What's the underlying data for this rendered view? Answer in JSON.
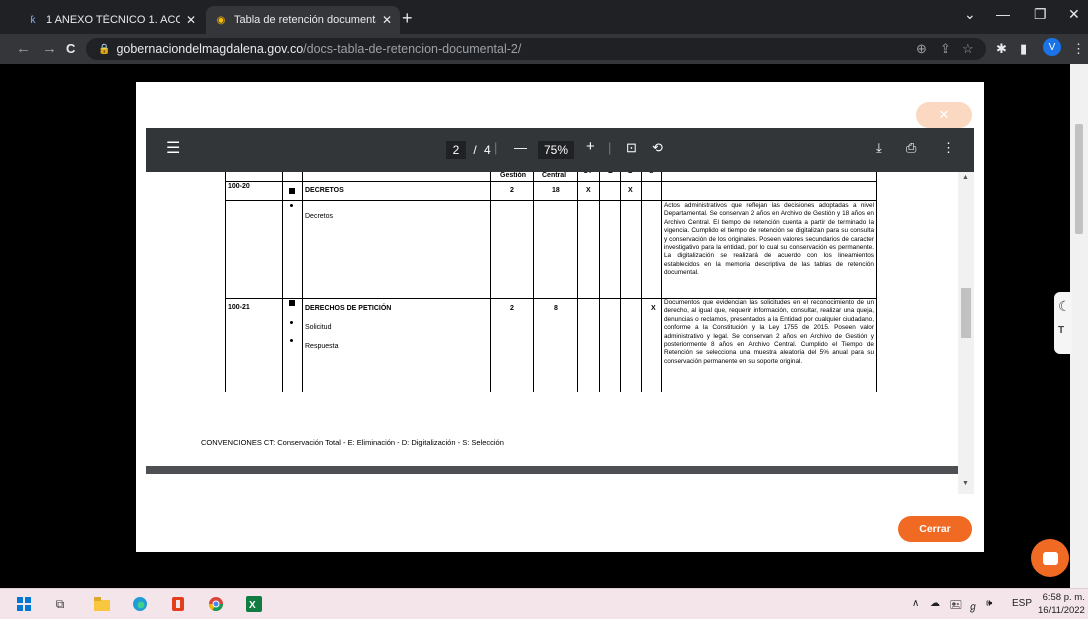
{
  "browser": {
    "tabs": [
      {
        "title": "1 ANEXO TÉCNICO 1. ACCESIBILI",
        "close": "✕"
      },
      {
        "title": "Tabla de retención documental 2",
        "close": "✕"
      }
    ],
    "new_tab": "+",
    "window_controls": [
      "⌄",
      "—",
      "❐",
      "✕"
    ],
    "nav": [
      "←",
      "→",
      "C"
    ],
    "url_host": "gobernaciondelmagdalena.gov.co",
    "url_path": "/docs-tabla-de-retencion-documental-2/",
    "right_icons": [
      "⊕",
      "⇪",
      "☆",
      "✱",
      "▮"
    ],
    "avatar": "V"
  },
  "modal": {
    "close_label": "✕",
    "cerrar_label": "Cerrar"
  },
  "pdf_toolbar": {
    "page_current": "2",
    "page_sep": "/",
    "page_total": "4",
    "zoom_out": "—",
    "zoom": "75%",
    "zoom_in": "+"
  },
  "doc": {
    "header_cols": [
      "Gestión",
      "Central",
      "CT",
      "E",
      "D",
      "S"
    ],
    "rows": [
      {
        "code": "100-20",
        "series": "DECRETOS",
        "gestion": "2",
        "central": "18",
        "marks": {
          "ct": "X",
          "e": "",
          "d": "X",
          "s": ""
        },
        "subseries": [
          "Decretos"
        ],
        "description": "Actos administrativos que reflejan las decisiones adoptadas a nivel Departamental. Se conservan 2 años en Archivo de Gestión y 18 años en Archivo Central. El tiempo de retención cuenta a partir de terminado la vigencia. Cumplido el tiempo de retención se digitalizan para su consulta y conservación de los originales. Poseen valores secundarios de caracter investigativo para la entidad, por lo cual su conservación es permanente. La digitalización se realizará de acuerdo con los lineamientos establecidos en la memoria descriptiva de las tablas de retención documental."
      },
      {
        "code": "100-21",
        "series": "DERECHOS DE PETICIÓN",
        "gestion": "2",
        "central": "8",
        "marks": {
          "ct": "",
          "e": "",
          "d": "",
          "s": "X"
        },
        "subseries": [
          "Solicitud",
          "Respuesta"
        ],
        "description": "Documentos que evidencian las solicitudes en el reconocimiento de un derecho, al igual que, requerir información, consultar, realizar una queja, denuncias o reclamos, presentados a la Entidad por cualquier ciudadano, conforme a la Constitución y la Ley 1755 de 2015. Poseen valor administrativo y legal. Se conservan 2 años en Archivo de Gestión y posteriormente 8 años en Archivo Central. Cumplido el Tiempo de Retención se selecciona una muestra aleatoria del 5% anual para su conservación permanente en su soporte original."
      }
    ],
    "conventions": "CONVENCIONES  CT: Conservación Total - E: Eliminación - D: Digitalización - S: Selección"
  },
  "taskbar": {
    "tray": [
      "∧",
      "☁",
      "🖭",
      "ℊ",
      "🕪",
      "ESP"
    ],
    "time": "6:58 p. m.",
    "date": "16/11/2022"
  },
  "colors": {
    "accent": "#f06a24",
    "toolbar": "#323639",
    "chrome": "#202124"
  }
}
